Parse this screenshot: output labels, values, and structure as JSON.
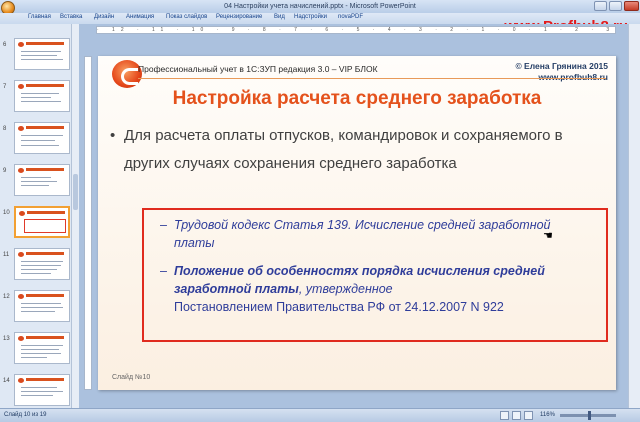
{
  "window": {
    "title": "04 Настройки учета начислений.pptx - Microsoft PowerPoint",
    "watermark": "www.Profbuh8.ru"
  },
  "ribbon": {
    "tabs": [
      "Главная",
      "Вставка",
      "Дизайн",
      "Анимация",
      "Показ слайдов",
      "Рецензирование",
      "Вид",
      "Надстройки",
      "novaPDF"
    ]
  },
  "thumbnails": {
    "numbers": [
      "6",
      "7",
      "8",
      "9",
      "10",
      "11",
      "12",
      "13",
      "14"
    ],
    "selected": "10"
  },
  "ruler": {
    "marks": "· 12 · 11 · 10 · 9 · 8 · 7 · 6 · 5 · 4 · 3 · 2 · 1 · 0 · 1 · 2 · 3 · 4 · 5 · 6 · 7 · 8 · 9 · 10 · 11 · 12 ·"
  },
  "slide": {
    "header": "Профессиональный учет в 1С:ЗУП редакция 3.0 – VIP БЛОК",
    "author_line1": "© Елена Грянина 2015",
    "author_line2": "www.profbuh8.ru",
    "title": "Настройка расчета среднего заработка",
    "bullet": "Для расчета оплаты отпусков, командировок и сохраняемого в других случаях сохранения среднего заработка",
    "sub1": "Трудовой кодекс Статья 139. Исчисление средней заработной платы",
    "sub2_bold": "Положение об особенностях порядка исчисления средней заработной платы",
    "sub2_rest": ", утвержденное",
    "sub2_line2": "Постановлением Правительства РФ от 24.12.2007 N 922",
    "number": "Слайд №10"
  },
  "statusbar": {
    "slide_info": "Слайд 10 из 19",
    "zoom": "116%"
  },
  "colors": {
    "title": "#e4521c",
    "accent_red": "#e02b1e",
    "link_blue": "#2f3d9a"
  }
}
